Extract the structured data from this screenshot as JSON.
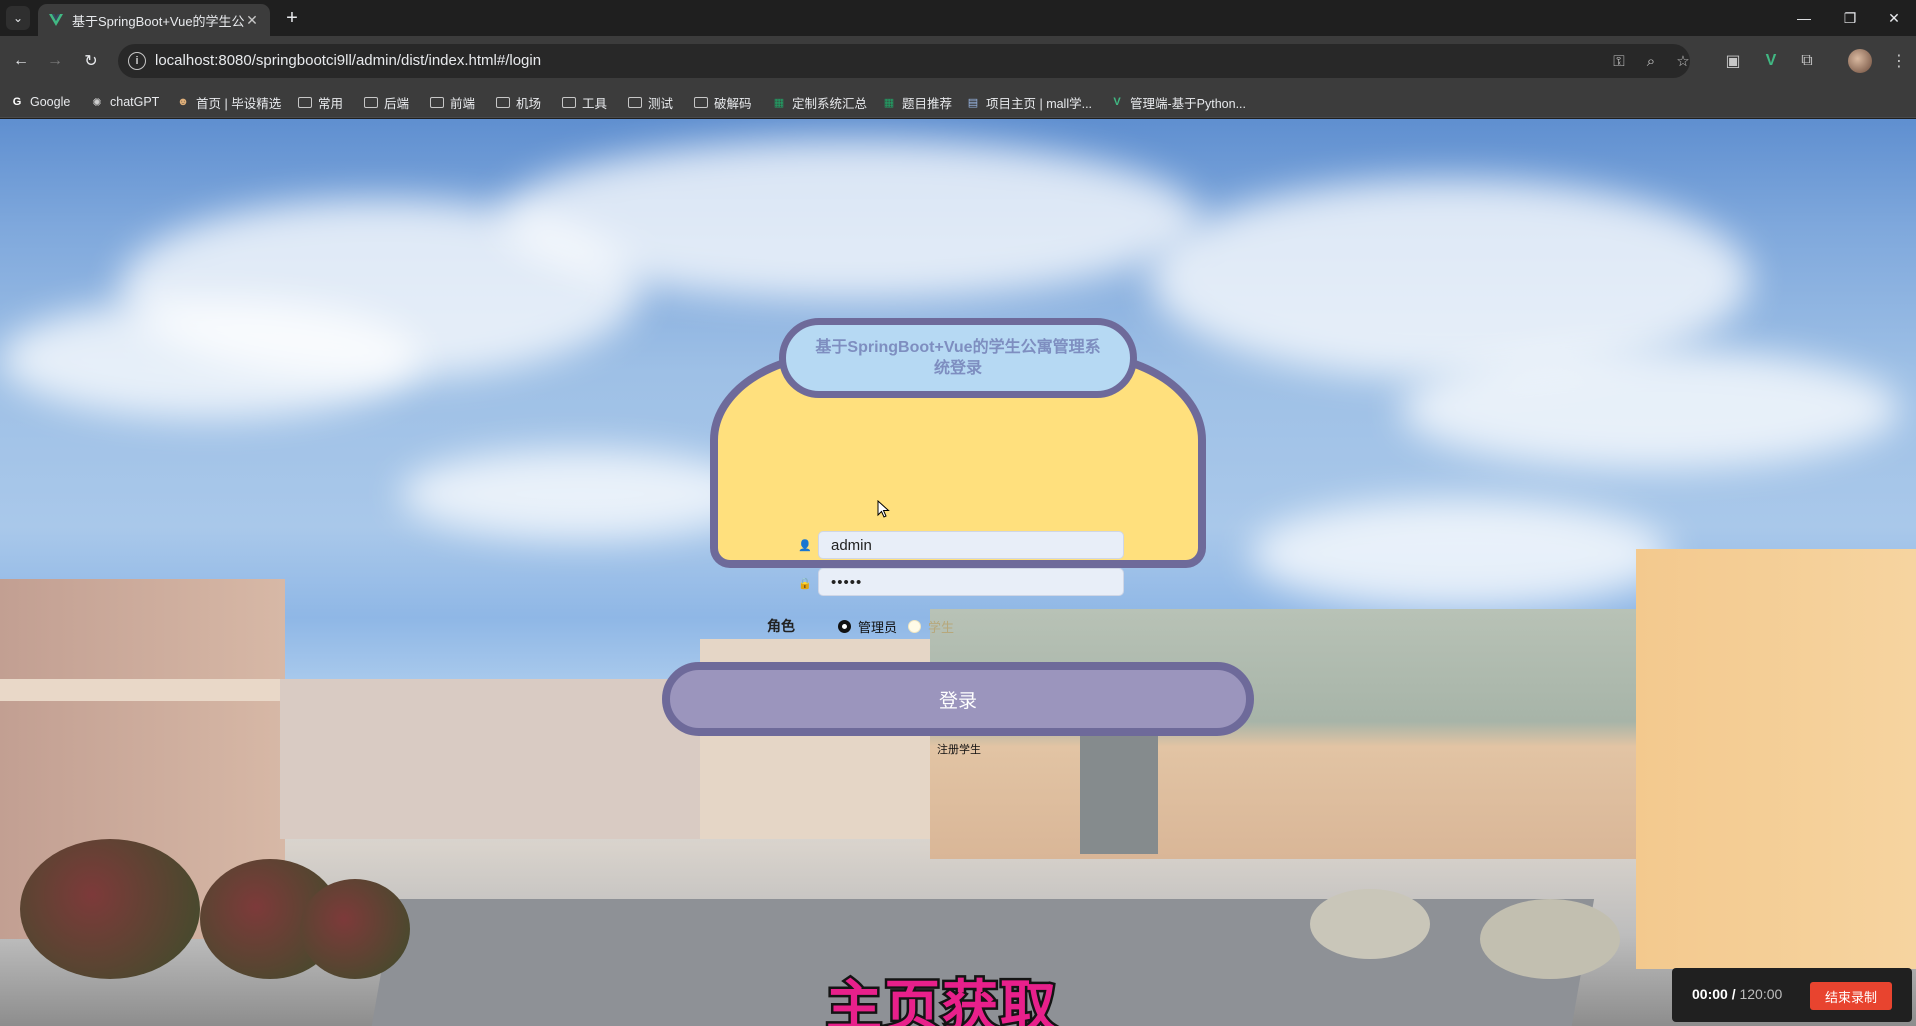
{
  "browser": {
    "tab_title": "基于SpringBoot+Vue的学生公",
    "url": "localhost:8080/springbootci9ll/admin/dist/index.html#/login",
    "accent_color": "#41b883"
  },
  "bookmarks": [
    {
      "label": "Google",
      "icon": "google-icon"
    },
    {
      "label": "chatGPT",
      "icon": "chatgpt-icon"
    },
    {
      "label": "首页 | 毕设精选",
      "icon": "site-icon"
    },
    {
      "label": "常用",
      "icon": "folder-icon"
    },
    {
      "label": "后端",
      "icon": "folder-icon"
    },
    {
      "label": "前端",
      "icon": "folder-icon"
    },
    {
      "label": "机场",
      "icon": "folder-icon"
    },
    {
      "label": "工具",
      "icon": "folder-icon"
    },
    {
      "label": "测试",
      "icon": "folder-icon"
    },
    {
      "label": "破解码",
      "icon": "folder-icon"
    },
    {
      "label": "定制系统汇总",
      "icon": "sheet-icon"
    },
    {
      "label": "题目推荐",
      "icon": "sheet-icon"
    },
    {
      "label": "项目主页 | mall学...",
      "icon": "page-icon"
    },
    {
      "label": "管理端-基于Python...",
      "icon": "vue-icon"
    }
  ],
  "login": {
    "title": "基于SpringBoot+Vue的学生公寓管理系统登录",
    "username_value": "admin",
    "password_value": "•••••",
    "role_label": "角色",
    "roles": [
      "管理员",
      "学生"
    ],
    "selected_role": "管理员",
    "login_button": "登录",
    "register_link": "注册学生"
  },
  "overlay": {
    "watermark": "主页获取",
    "rec_time": "00:00 /",
    "rec_total": " 120:00",
    "rec_button": "结束录制"
  }
}
